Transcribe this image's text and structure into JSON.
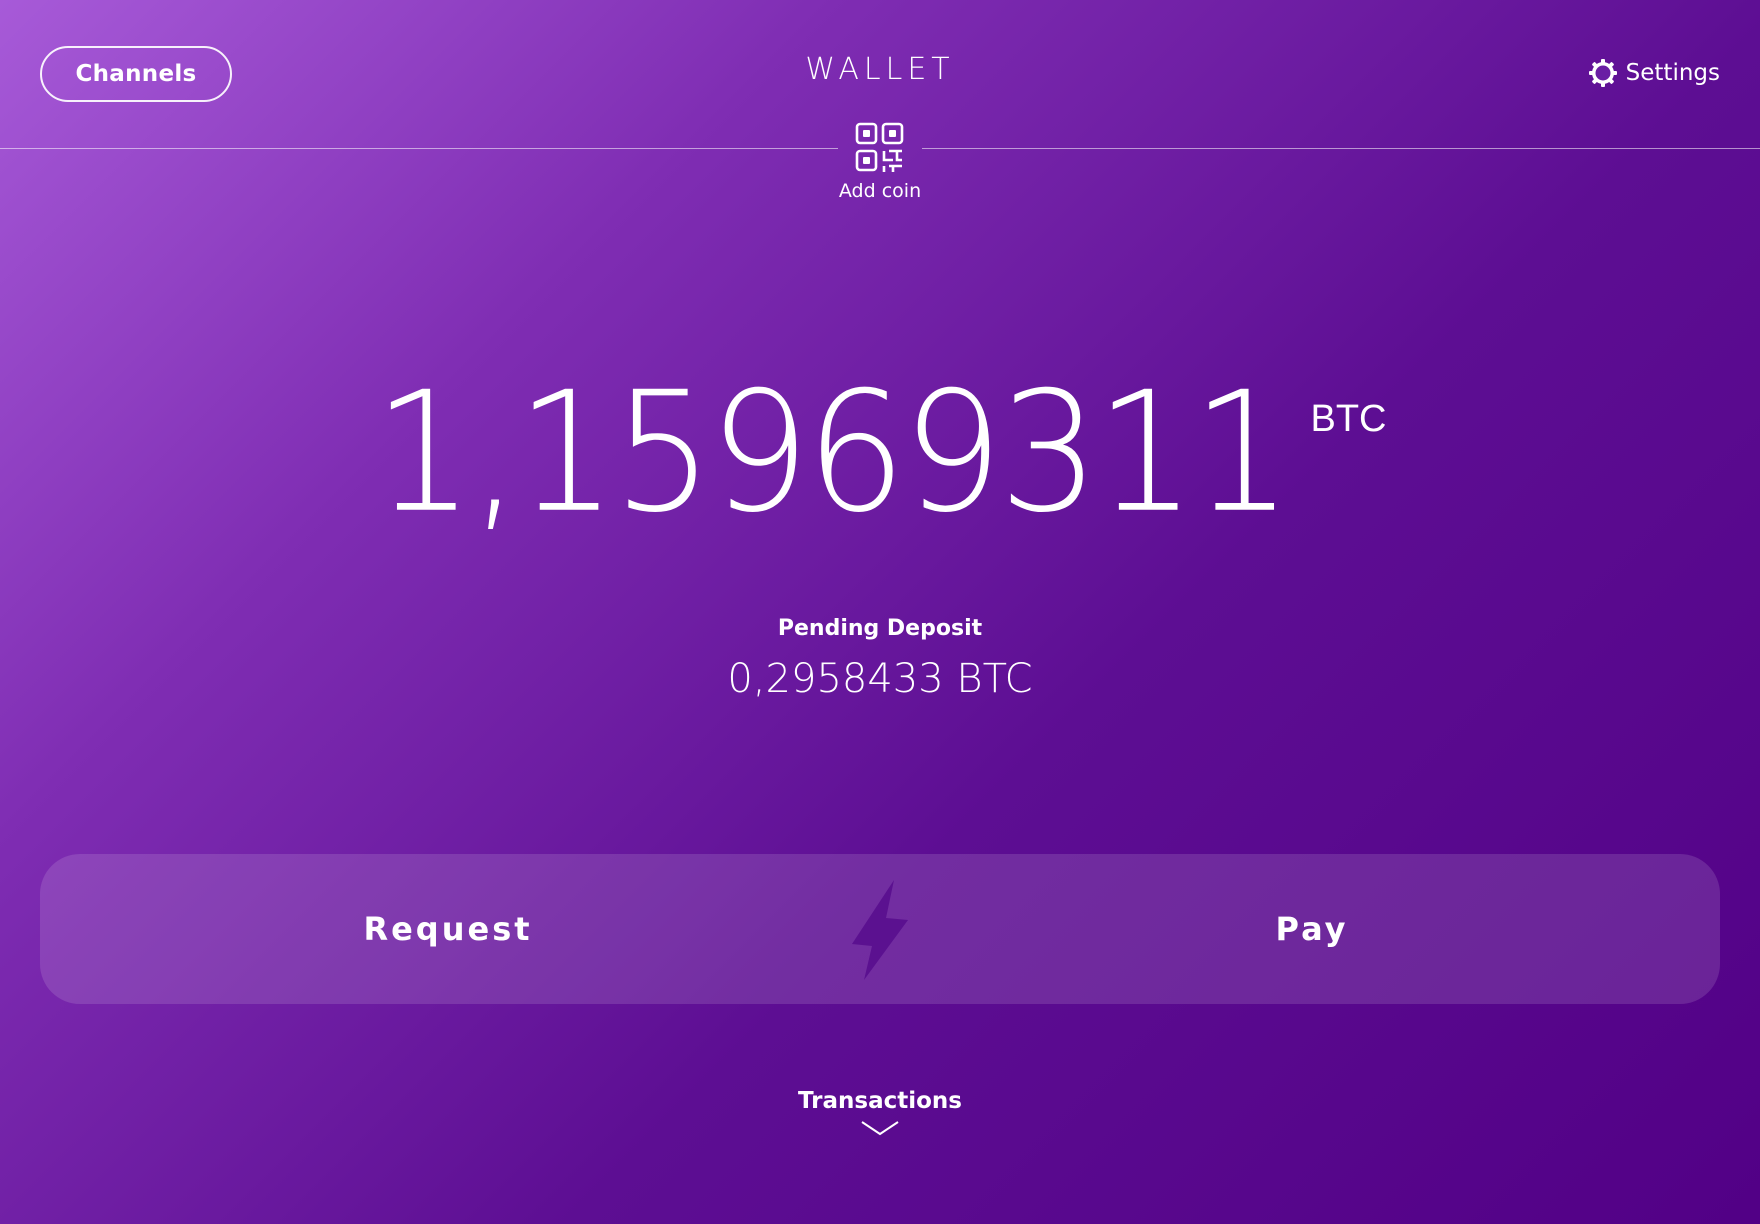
{
  "header": {
    "channels_label": "Channels",
    "title": "WALLET",
    "settings_label": "Settings",
    "settings_icon": "gear-icon"
  },
  "add_coin": {
    "label": "Add coin",
    "icon": "qr-code-icon"
  },
  "balance": {
    "amount": "1,15969311",
    "unit": "BTC"
  },
  "pending": {
    "label": "Pending Deposit",
    "amount": "0,2958433 BTC"
  },
  "actions": {
    "request_label": "Request",
    "pay_label": "Pay",
    "center_icon": "lightning-bolt-icon"
  },
  "transactions": {
    "label": "Transactions",
    "icon": "chevron-down-icon"
  },
  "colors": {
    "gradient_start": "#a75ad8",
    "gradient_end": "#520086",
    "bolt": "#5b1190",
    "text": "#ffffff"
  }
}
